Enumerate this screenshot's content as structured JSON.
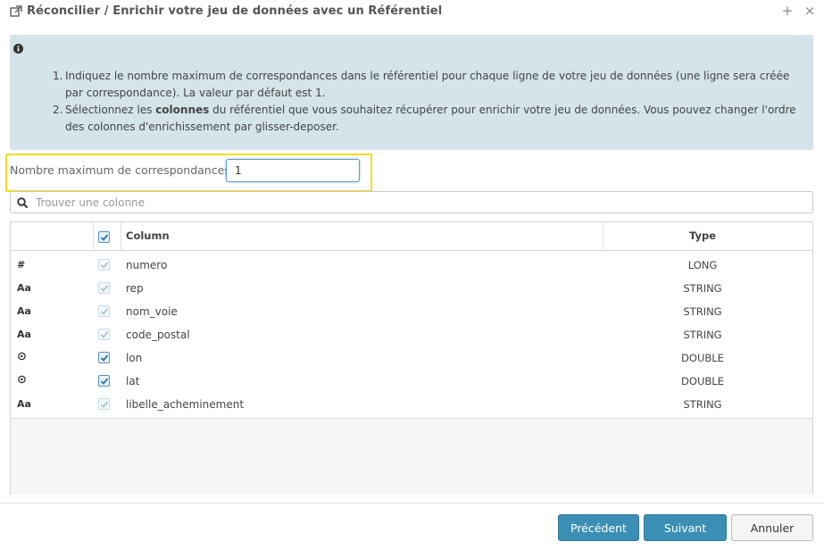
{
  "dialog": {
    "title": "Réconcilier / Enrichir votre jeu de données avec un Référentiel",
    "close_glyph": "×",
    "maximize_glyph": "+"
  },
  "info": {
    "item1_num": "1.",
    "item1": "Indiquez le nombre maximum de correspondances dans le référentiel pour chaque ligne de votre jeu de données (une ligne sera créée par correspondance). La valeur par défaut est 1.",
    "item2_num": "2.",
    "item2_prefix": "Sélectionnez les ",
    "item2_bold": "colonnes",
    "item2_suffix": " du référentiel que vous souhaitez récupérer pour enrichir votre jeu de données. Vous pouvez changer l'ordre des colonnes d'enrichissement par glisser-deposer."
  },
  "max_matches": {
    "label": "Nombre maximum de correspondances",
    "value": "1"
  },
  "search": {
    "placeholder": "Trouver une colonne"
  },
  "grid": {
    "headers": {
      "column": "Column",
      "type": "Type"
    },
    "rows": [
      {
        "icon": "#",
        "icon_name": "number-hash-icon",
        "name": "numero",
        "type": "LONG",
        "checked": true,
        "disabled": true
      },
      {
        "icon": "Aa",
        "icon_name": "text-type-icon",
        "name": "rep",
        "type": "STRING",
        "checked": true,
        "disabled": true
      },
      {
        "icon": "Aa",
        "icon_name": "text-type-icon",
        "name": "nom_voie",
        "type": "STRING",
        "checked": true,
        "disabled": true
      },
      {
        "icon": "Aa",
        "icon_name": "text-type-icon",
        "name": "code_postal",
        "type": "STRING",
        "checked": true,
        "disabled": true
      },
      {
        "icon": "⊙",
        "icon_name": "circle-dot-icon",
        "name": "lon",
        "type": "DOUBLE",
        "checked": true,
        "disabled": false
      },
      {
        "icon": "⊙",
        "icon_name": "circle-dot-icon",
        "name": "lat",
        "type": "DOUBLE",
        "checked": true,
        "disabled": false
      },
      {
        "icon": "Aa",
        "icon_name": "text-type-icon",
        "name": "libelle_acheminement",
        "type": "STRING",
        "checked": true,
        "disabled": true
      }
    ]
  },
  "buttons": {
    "previous": "Précédent",
    "next": "Suivant",
    "cancel": "Annuler"
  },
  "colors": {
    "primary": "#3c8fb4",
    "info_bg": "#d5e3ea",
    "highlight": "#f5dc1f"
  }
}
